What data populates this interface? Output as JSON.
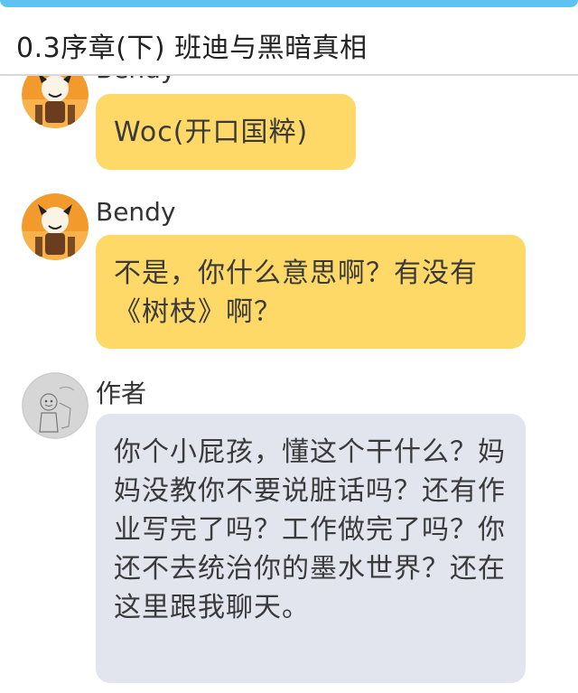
{
  "header": {
    "title": "0.3序章(下) 班迪与黑暗真相"
  },
  "messages": [
    {
      "sender": "Bendy",
      "text": "Woc(开口国粹)"
    },
    {
      "sender": "Bendy",
      "text": "不是，你什么意思啊？有没有《树枝》啊？"
    },
    {
      "sender": "作者",
      "avatar_signature": "Bendy",
      "text": "你个小屁孩，懂这个干什么？妈妈没教你不要说脏话吗？还有作业写完了吗？工作做完了吗？你还不去统治你的墨水世界？还在这里跟我聊天。"
    }
  ],
  "colors": {
    "top_accent": "#5ec3f2",
    "bubble_yellow": "#fed967",
    "bubble_grey": "#e2e5ee",
    "text": "#3a3a3a"
  }
}
